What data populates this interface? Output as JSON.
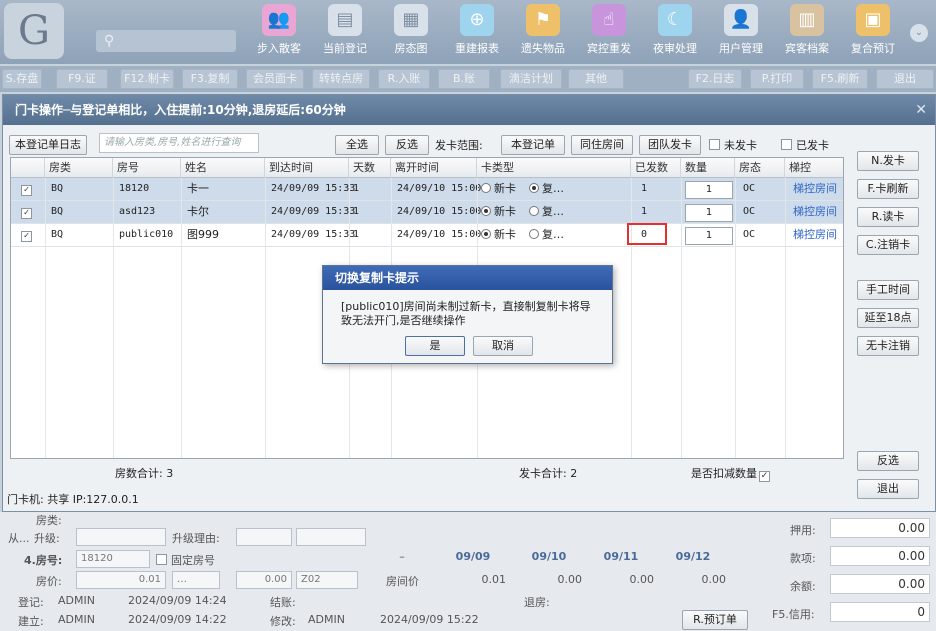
{
  "top_icons": [
    {
      "label": "步入散客",
      "icon": "walk-in-icon"
    },
    {
      "label": "当前登记",
      "icon": "checkin-icon"
    },
    {
      "label": "房态图",
      "icon": "room-status-icon"
    },
    {
      "label": "重建报表",
      "icon": "rebuild-report-icon"
    },
    {
      "label": "遗失物品",
      "icon": "lost-items-icon"
    },
    {
      "label": "宾控重发",
      "icon": "resend-icon"
    },
    {
      "label": "夜审处理",
      "icon": "night-audit-icon"
    },
    {
      "label": "用户管理",
      "icon": "user-icon"
    },
    {
      "label": "宾客档案",
      "icon": "guest-file-icon"
    },
    {
      "label": "复合预订",
      "icon": "booking-icon"
    }
  ],
  "toolbar": [
    "S.存盘",
    "F9.证",
    "F12.制卡",
    "F3.复制",
    "会员面卡",
    "转转点房",
    "R.入账",
    "B.账",
    "滴洁计划",
    "其他",
    "F2.日志",
    "P.打印",
    "F5.刷新",
    "退出"
  ],
  "dialog": {
    "title": "门卡操作─与登记单相比，入住提前:10分钟,退房延后:60分钟",
    "log_btn": "本登记单日志",
    "search_placeholder": "请输入房类,房号,姓名进行查询",
    "select_all": "全选",
    "invert": "反选",
    "range_label": "发卡范围:",
    "range_btns": [
      "本登记单",
      "同住房间",
      "团队发卡"
    ],
    "unissued": "未发卡",
    "issued": "已发卡",
    "headers": [
      "房类",
      "房号",
      "姓名",
      "到达时间",
      "天数",
      "离开时间",
      "卡类型",
      "已发数",
      "数量",
      "房态",
      "梯控"
    ],
    "rows": [
      {
        "type": "BQ",
        "room": "18120",
        "name": "卡一",
        "arrive": "24/09/09 15:33",
        "days": "1",
        "leave": "24/09/10 15:00",
        "new": "新卡",
        "copy": "复…",
        "issued": "1",
        "qty": "1",
        "state": "OC",
        "lift": "梯控房间",
        "newon": false
      },
      {
        "type": "BQ",
        "room": "asd123",
        "name": "卡尔",
        "arrive": "24/09/09 15:33",
        "days": "1",
        "leave": "24/09/10 15:00",
        "new": "新卡",
        "copy": "复…",
        "issued": "1",
        "qty": "1",
        "state": "OC",
        "lift": "梯控房间",
        "newon": true
      },
      {
        "type": "BQ",
        "room": "public010",
        "name": "图999",
        "arrive": "24/09/09 15:33",
        "days": "1",
        "leave": "24/09/10 15:00",
        "new": "新卡",
        "copy": "复…",
        "issued": "0",
        "qty": "1",
        "state": "OC",
        "lift": "梯控房间",
        "newon": true
      }
    ],
    "side_btns": [
      "N.发卡",
      "F.卡刷新",
      "R.读卡",
      "C.注销卡",
      "手工时间",
      "延至18点",
      "无卡注销"
    ],
    "room_total": "房数合计: 3",
    "card_total": "发卡合计: 2",
    "deduct": "是否扣减数量",
    "bottom_invert": "反选",
    "bottom_exit": "退出",
    "machine": "门卡机: 共享 IP:127.0.0.1"
  },
  "popup": {
    "title": "切换复制卡提示",
    "message": "[public010]房间尚未制过新卡，直接制复制卡将导致无法开门,是否继续操作",
    "yes": "是",
    "cancel": "取消"
  },
  "bottom": {
    "room_type_label": "房类:",
    "from_label": "从...",
    "upgrade_label": "升级:",
    "upgrade_reason": "升级理由:",
    "room_no_label": "4.房号:",
    "room_no": "18120",
    "fixed_room": "固定房号",
    "price_label": "房价:",
    "price": "0.01",
    "price2": "0.00",
    "code": "Z02",
    "price_col": "房间价",
    "dates": [
      "09/09",
      "09/10",
      "09/11",
      "09/12"
    ],
    "date_vals": [
      "0.01",
      "0.00",
      "0.00",
      "0.00"
    ],
    "reg_label": "登记:",
    "reg_user": "ADMIN",
    "reg_time": "2024/09/09 14:24",
    "build_label": "建立:",
    "build_user": "ADMIN",
    "build_time": "2024/09/09 14:22",
    "settle_label": "结账:",
    "checkout_label": "退房:",
    "modify_label": "修改:",
    "modify_user": "ADMIN",
    "modify_time": "2024/09/09 15:22",
    "prebook_btn": "R.预订单",
    "side": [
      {
        "label": "押用:",
        "value": "0.00"
      },
      {
        "label": "款项:",
        "value": "0.00"
      },
      {
        "label": "余额:",
        "value": "0.00"
      },
      {
        "label": "F5.信用:",
        "value": "0"
      }
    ]
  }
}
